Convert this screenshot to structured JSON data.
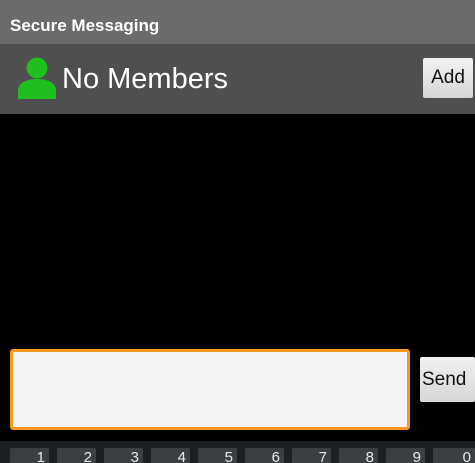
{
  "app": {
    "title": "Secure Messaging"
  },
  "header": {
    "members_label": "No Members",
    "add_label": "Add",
    "icon": "person-icon",
    "icon_color": "#1fbf1f"
  },
  "composer": {
    "message_value": "",
    "send_label": "Send",
    "focus_color": "#f39a1e"
  },
  "keyboard": {
    "keys": [
      "1",
      "2",
      "3",
      "4",
      "5",
      "6",
      "7",
      "8",
      "9",
      "0"
    ]
  }
}
